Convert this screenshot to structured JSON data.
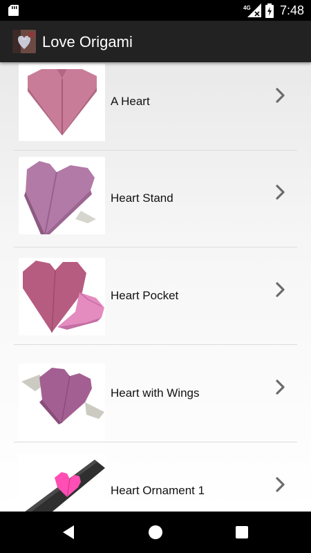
{
  "status_bar": {
    "time": "7:48",
    "network": "4G",
    "icons": [
      "sd-card-icon",
      "signal-icon",
      "battery-icon"
    ]
  },
  "app_bar": {
    "title": "Love Origami",
    "logo_icon": "app-logo-icon"
  },
  "items": [
    {
      "label": "A Heart"
    },
    {
      "label": "Heart Stand"
    },
    {
      "label": "Heart Pocket"
    },
    {
      "label": "Heart with Wings"
    },
    {
      "label": "Heart Ornament 1"
    }
  ],
  "nav_bar": {
    "buttons": [
      "back-icon",
      "home-icon",
      "recents-icon"
    ]
  },
  "colors": {
    "app_bar": "#222222",
    "status_bar": "#000000",
    "heart_pink": "#c7708c",
    "heart_purple": "#a9628f",
    "chevron": "#6b6b6b"
  }
}
